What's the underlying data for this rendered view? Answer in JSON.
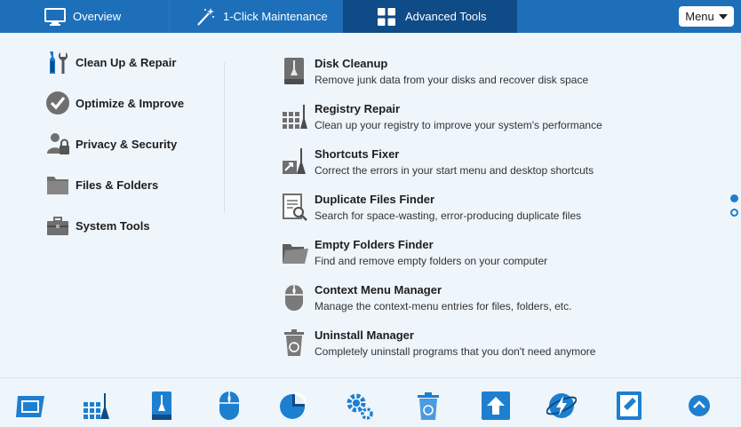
{
  "top_nav": {
    "tabs": [
      {
        "label": "Overview",
        "icon": "monitor-icon"
      },
      {
        "label": "1-Click Maintenance",
        "icon": "magic-wand-icon"
      },
      {
        "label": "Advanced Tools",
        "icon": "grid-tiles-icon"
      }
    ],
    "menu_label": "Menu"
  },
  "categories": [
    {
      "label": "Clean Up & Repair",
      "icon": "wrench-brush-icon"
    },
    {
      "label": "Optimize & Improve",
      "icon": "checkmark-circle-icon"
    },
    {
      "label": "Privacy & Security",
      "icon": "user-lock-icon"
    },
    {
      "label": "Files & Folders",
      "icon": "folder-icon"
    },
    {
      "label": "System Tools",
      "icon": "toolbox-icon"
    }
  ],
  "tools": [
    {
      "title": "Disk Cleanup",
      "description": "Remove junk data from your disks and recover disk space",
      "icon": "disk-broom-icon"
    },
    {
      "title": "Registry Repair",
      "description": "Clean up your registry to improve your system's performance",
      "icon": "registry-grid-icon"
    },
    {
      "title": "Shortcuts Fixer",
      "description": "Correct the errors in your start menu and desktop shortcuts",
      "icon": "shortcut-broom-icon"
    },
    {
      "title": "Duplicate Files Finder",
      "description": "Search for space-wasting, error-producing duplicate files",
      "icon": "document-magnifier-icon"
    },
    {
      "title": "Empty Folders Finder",
      "description": "Find and remove empty folders on your computer",
      "icon": "open-folder-icon"
    },
    {
      "title": "Context Menu Manager",
      "description": "Manage the context-menu entries for files, folders, etc.",
      "icon": "mouse-icon"
    },
    {
      "title": "Uninstall Manager",
      "description": "Completely uninstall programs that you don't need anymore",
      "icon": "recycle-bin-icon"
    }
  ],
  "dock": [
    {
      "icon": "window-icon"
    },
    {
      "icon": "registry-broom-icon"
    },
    {
      "icon": "disk-cleanup-icon"
    },
    {
      "icon": "mouse-icon"
    },
    {
      "icon": "pie-chart-icon"
    },
    {
      "icon": "gears-icon"
    },
    {
      "icon": "recycle-bin-icon"
    },
    {
      "icon": "upload-arrow-icon"
    },
    {
      "icon": "globe-lightning-icon"
    },
    {
      "icon": "tablet-icon"
    },
    {
      "icon": "chevron-up-icon"
    }
  ],
  "colors": {
    "accent": "#1d6fba",
    "active_tab": "#0f4b86",
    "background": "#eef5fb"
  }
}
